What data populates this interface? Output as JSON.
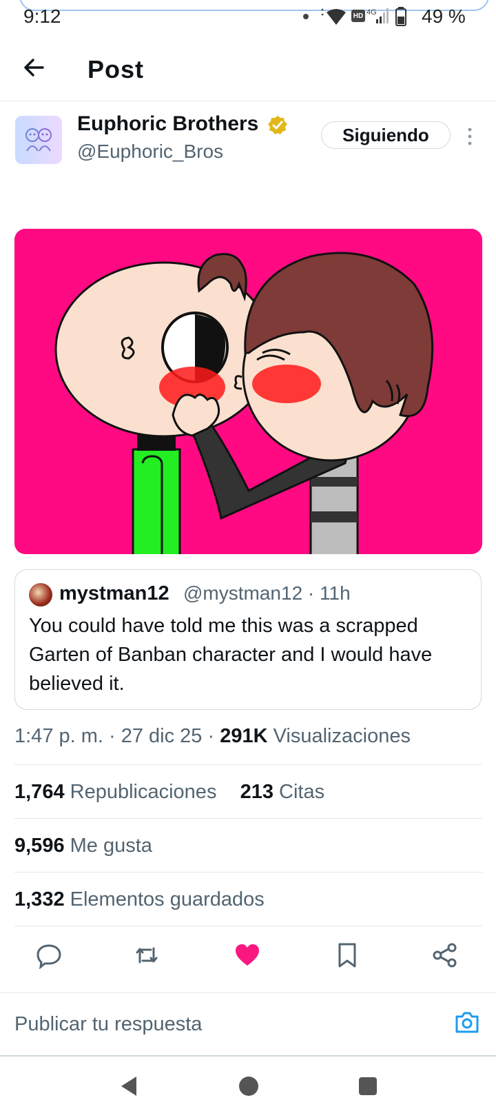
{
  "status": {
    "time": "9:12",
    "battery": "49 %",
    "hd": "HD",
    "net": "4G"
  },
  "header": {
    "title": "Post"
  },
  "author": {
    "name": "Euphoric Brothers",
    "handle": "@Euphoric_Bros",
    "follow_label": "Siguiendo"
  },
  "quote": {
    "name": "mystman12",
    "meta": "@mystman12 · 11h",
    "text": "You could have told me this was a scrapped Garten of Banban character and I would have believed it."
  },
  "meta": {
    "time": "1:47 p. m. · 27 dic 25 · ",
    "views_count": "291K",
    "views_label": "Visualizaciones"
  },
  "stats": {
    "reposts_count": "1,764",
    "reposts_label": "Republicaciones",
    "quotes_count": "213",
    "quotes_label": "Citas",
    "likes_count": "9,596",
    "likes_label": "Me gusta",
    "bookmarks_count": "1,332",
    "bookmarks_label": "Elementos guardados"
  },
  "reply": {
    "placeholder": "Publicar tu respuesta"
  },
  "colors": {
    "like": "#f91880",
    "link": "#1d9bf0",
    "media_bg": "#ff0a82",
    "verified": "#e2b719"
  },
  "icons": [
    "back-arrow-icon",
    "verified-badge-icon",
    "more-icon",
    "reply-icon",
    "repost-icon",
    "like-icon",
    "bookmark-icon",
    "share-icon",
    "camera-icon",
    "nav-back-icon",
    "nav-home-icon",
    "nav-recents-icon"
  ]
}
